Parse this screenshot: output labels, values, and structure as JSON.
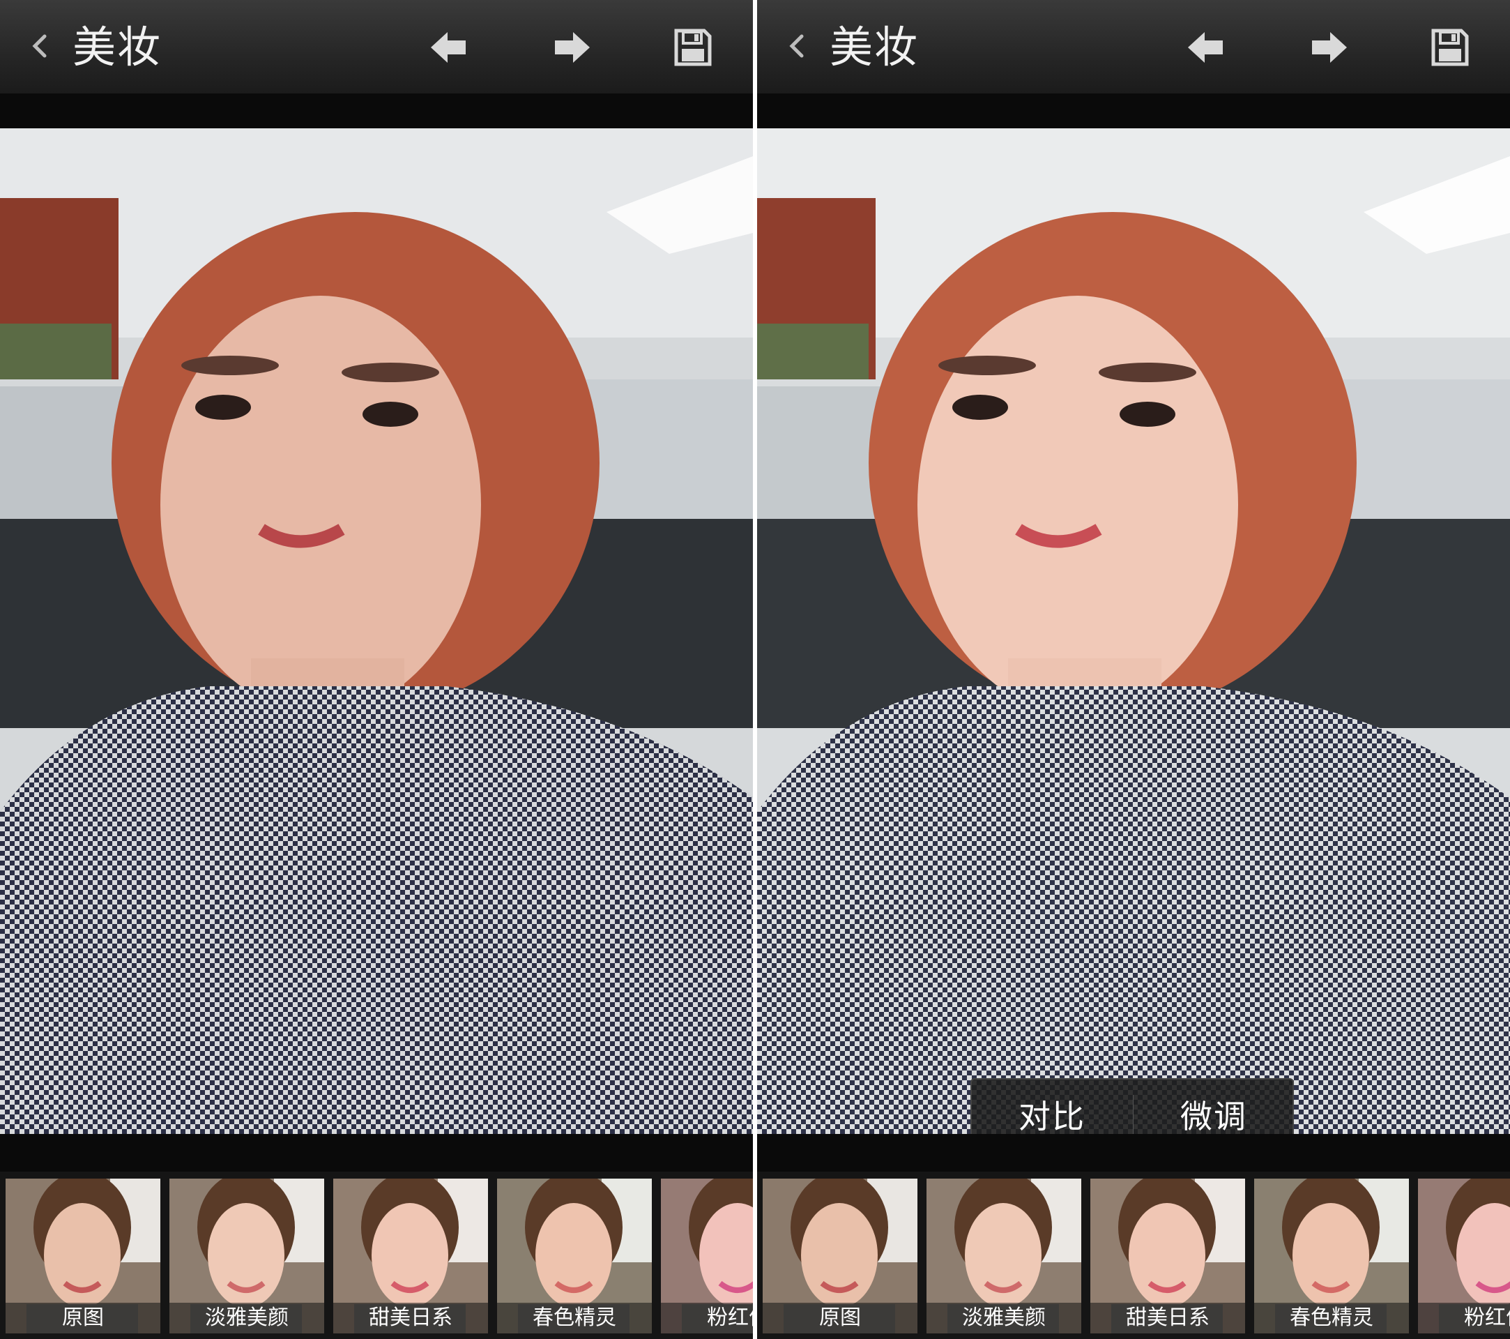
{
  "screens": [
    {
      "id": "before",
      "title": "美妆",
      "selected_filter": 0,
      "show_adjust_bar": false,
      "filters": [
        {
          "label": "原图"
        },
        {
          "label": "淡雅美颜"
        },
        {
          "label": "甜美日系"
        },
        {
          "label": "春色精灵"
        },
        {
          "label": "粉红佳"
        }
      ]
    },
    {
      "id": "after",
      "title": "美妆",
      "selected_filter": 1,
      "show_adjust_bar": true,
      "adjust_bar": {
        "compare_label": "对比",
        "tune_label": "微调"
      },
      "filters": [
        {
          "label": "原图"
        },
        {
          "label": "淡雅美颜"
        },
        {
          "label": "甜美日系"
        },
        {
          "label": "春色精灵"
        },
        {
          "label": "粉红佳"
        }
      ]
    }
  ],
  "icons": {
    "back": "chevron-left-icon",
    "undo": "arrow-left-icon",
    "redo": "arrow-right-icon",
    "save": "floppy-disk-icon"
  },
  "colors": {
    "selected_outline": "#2fc47a",
    "toolbar_bg": "#2a2a2a"
  }
}
